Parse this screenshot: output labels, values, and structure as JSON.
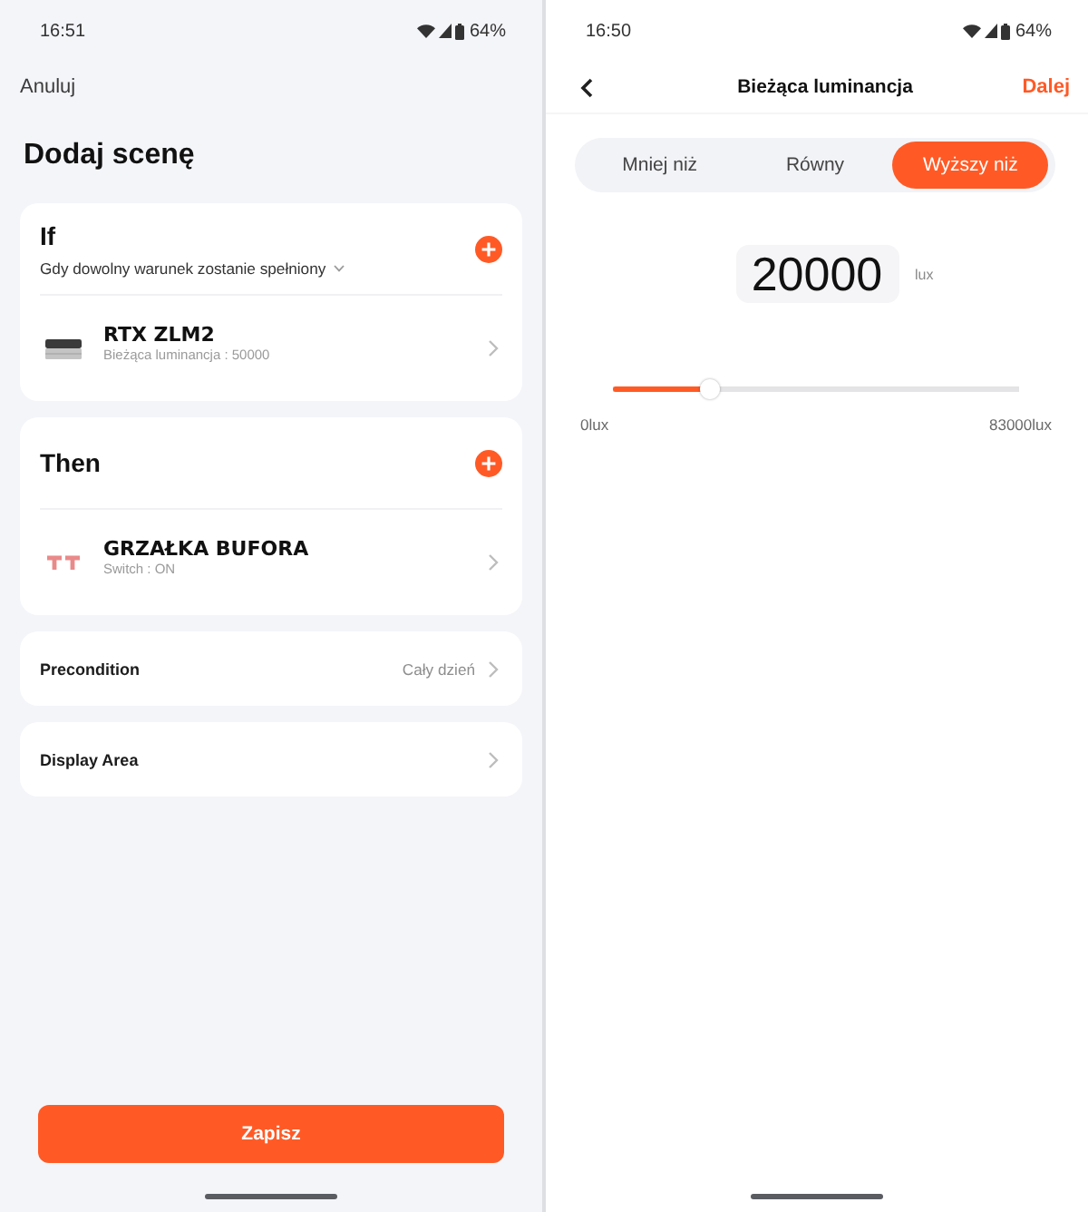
{
  "scene_editor": {
    "status_bar": {
      "time": "16:51",
      "battery": "64%"
    },
    "cancel_link": "Anuluj",
    "title": "Dodaj scenę",
    "cards": [
      {
        "title": "If",
        "match_mode": "Gdy dowolny warunek zostanie spełniony",
        "items": [
          {
            "kind": "sensor",
            "name": "RTX ZLM2",
            "detail": "Bieżąca luminancja : 50000"
          }
        ]
      },
      {
        "title": "Then",
        "items": [
          {
            "kind": "switch",
            "name": "GRZAŁKA BUFORA",
            "detail": "Switch : ON"
          }
        ]
      }
    ],
    "settings": [
      {
        "label": "Precondition",
        "value": "Cały dzień"
      },
      {
        "label": "Display Area"
      }
    ],
    "save_button": "Zapisz"
  },
  "luminance_editor": {
    "status_bar": {
      "time": "16:50",
      "battery": "64%"
    },
    "title": "Bieżąca luminancja",
    "next_link": "Dalej",
    "comparison_tabs": [
      {
        "label": "Mniej niż",
        "selected": false
      },
      {
        "label": "Równy",
        "selected": false
      },
      {
        "label": "Wyższy niż",
        "selected": true
      }
    ],
    "value": "20000",
    "unit": "lux",
    "slider": {
      "level": 0.24,
      "min_label": "0lux",
      "max_label": "83000lux"
    }
  }
}
